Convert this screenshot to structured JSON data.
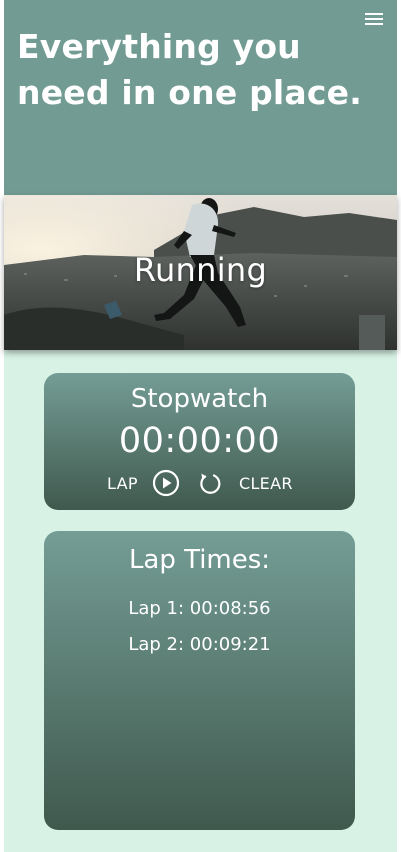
{
  "header": {
    "headline": "Everything you need in one place.",
    "menu_icon": "hamburger-menu-icon"
  },
  "hero": {
    "title": "Running"
  },
  "stopwatch": {
    "title": "Stopwatch",
    "time": "00:00:00",
    "lap_label": "LAP",
    "clear_label": "CLEAR",
    "play_icon": "play-circle-icon",
    "reset_icon": "reset-arrow-icon"
  },
  "laps": {
    "title": "Lap Times:",
    "items": [
      "Lap 1: 00:08:56",
      "Lap 2: 00:09:21"
    ]
  },
  "colors": {
    "header_bg": "#729b93",
    "content_bg": "#d8f3e6",
    "card_top": "#749d95",
    "card_bottom": "#40594e",
    "text": "#ffffff"
  }
}
